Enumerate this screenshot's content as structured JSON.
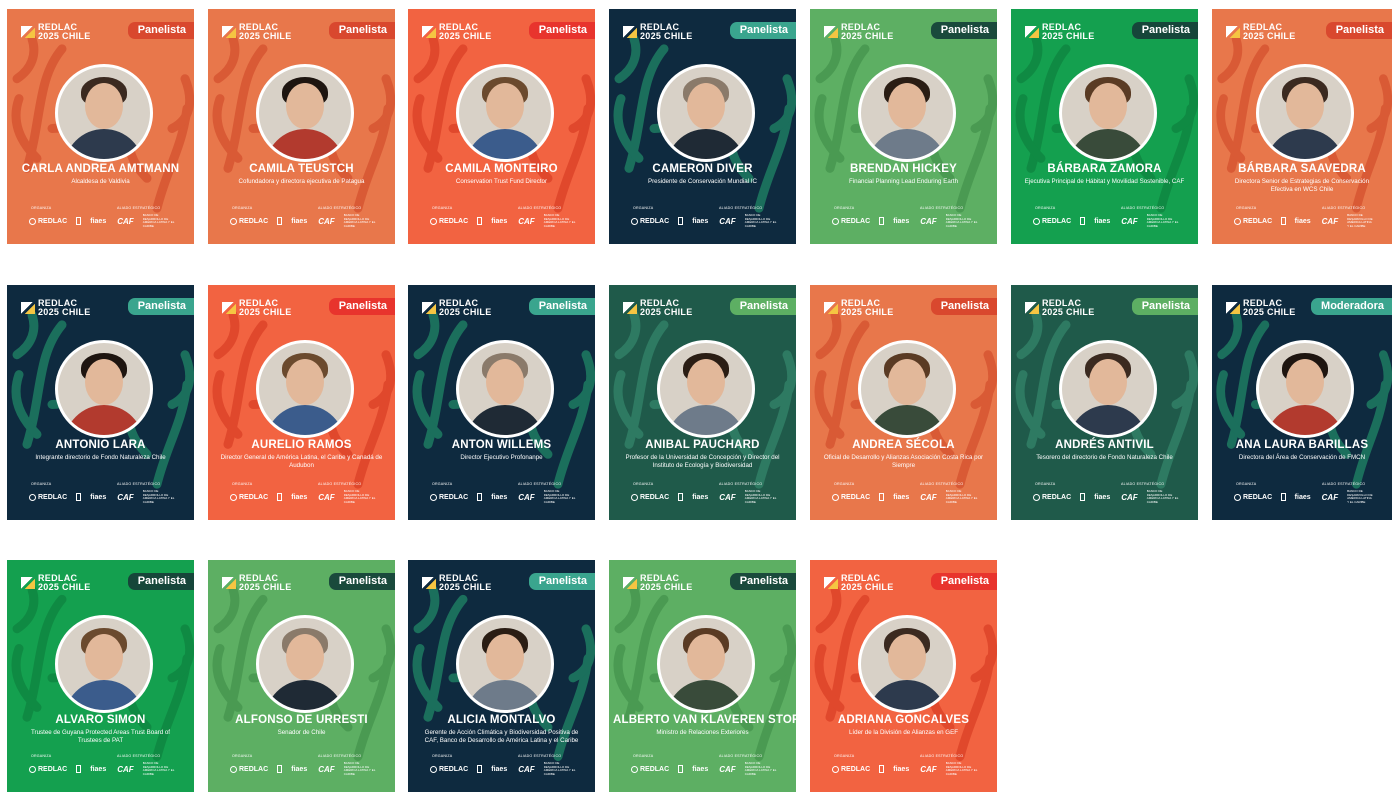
{
  "brand": {
    "line1": "REDLAC",
    "line2": "2025 CHILE"
  },
  "footer": {
    "organiza_label": "ORGANIZA",
    "aliado_label": "ALIADO ESTRATÉGICO",
    "redlac_logo": "REDLAC",
    "fiaes_logo": "fiaes",
    "caf_logo": "CAF",
    "caf_tagline": "BANCO DE DESARROLLO DE AMÉRICA LATINA Y EL CARIBE"
  },
  "colors": {
    "orange": "#e8774b",
    "red": "#f26341",
    "navy": "#0e2a3f",
    "green": "#5daf63",
    "brightgreen": "#14a04f",
    "darkgreen": "#1f5a4a"
  },
  "cards": [
    {
      "name": "CARLA ANDREA AMTMANN",
      "role": "Alcaldesa de Valdivia",
      "badge": "Panelista",
      "theme": "orange"
    },
    {
      "name": "CAMILA TEUSTCH",
      "role": "Cofundadora y directora ejecutiva de Patagua",
      "badge": "Panelista",
      "theme": "orange"
    },
    {
      "name": "CAMILA MONTEIRO",
      "role": "Conservation Trust Fund Director",
      "badge": "Panelista",
      "theme": "red"
    },
    {
      "name": "CAMERON DIVER",
      "role": "Presidente de Conservación Mundial IC",
      "badge": "Panelista",
      "theme": "navy"
    },
    {
      "name": "BRENDAN HICKEY",
      "role": "Financial Planning Lead Enduring Earth",
      "badge": "Panelista",
      "theme": "green"
    },
    {
      "name": "BÁRBARA ZAMORA",
      "role": "Ejecutiva Principal de Hábitat y Movilidad Sostenible, CAF",
      "badge": "Panelista",
      "theme": "brightgreen"
    },
    {
      "name": "BÁRBARA SAAVEDRA",
      "role": "Directora Senior de Estrategias de Conservación Efectiva en WCS Chile",
      "badge": "Panelista",
      "theme": "orange"
    },
    {
      "name": "ANTONIO LARA",
      "role": "Integrante directorio de Fondo Naturaleza Chile",
      "badge": "Panelista",
      "theme": "navy"
    },
    {
      "name": "AURELIO RAMOS",
      "role": "Director General de América Latina, el Caribe y Canadá de Audubon",
      "badge": "Panelista",
      "theme": "red"
    },
    {
      "name": "ANTON WILLEMS",
      "role": "Director Ejecutivo Profonanpe",
      "badge": "Panelista",
      "theme": "navy"
    },
    {
      "name": "ANIBAL PAUCHARD",
      "role": "Profesor de la Universidad de Concepción y Director del Instituto de Ecología y Biodiversidad",
      "badge": "Panelista",
      "theme": "darkgreen"
    },
    {
      "name": "ANDREA SÉCOLA",
      "role": "Oficial de Desarrollo y Alianzas Asociación Costa Rica por Siempre",
      "badge": "Panelista",
      "theme": "orange"
    },
    {
      "name": "ANDRÉS ANTIVIL",
      "role": "Tesorero del directorio de Fondo Naturaleza Chile",
      "badge": "Panelista",
      "theme": "darkgreen"
    },
    {
      "name": "ANA LAURA BARILLAS",
      "role": "Directora del Área de Conservación de FMCN",
      "badge": "Moderadora",
      "theme": "navy"
    },
    {
      "name": "ALVARO SIMON",
      "role": "Trustee de Guyana Protected Areas Trust Board of Trustees de PAT",
      "badge": "Panelista",
      "theme": "brightgreen"
    },
    {
      "name": "ALFONSO DE URRESTI",
      "role": "Senador de Chile",
      "badge": "Panelista",
      "theme": "green"
    },
    {
      "name": "ALICIA MONTALVO",
      "role": "Gerente de Acción Climática y Biodiversidad Positiva de CAF, Banco de Desarrollo de América Latina y el Caribe",
      "badge": "Panelista",
      "theme": "navy"
    },
    {
      "name": "ALBERTO VAN KLAVEREN STORK",
      "role": "Ministro de Relaciones Exteriores",
      "badge": "Panelista",
      "theme": "green"
    },
    {
      "name": "ADRIANA GONCALVES",
      "role": "Líder de la División de Alianzas en GEF",
      "badge": "Panelista",
      "theme": "red"
    }
  ]
}
